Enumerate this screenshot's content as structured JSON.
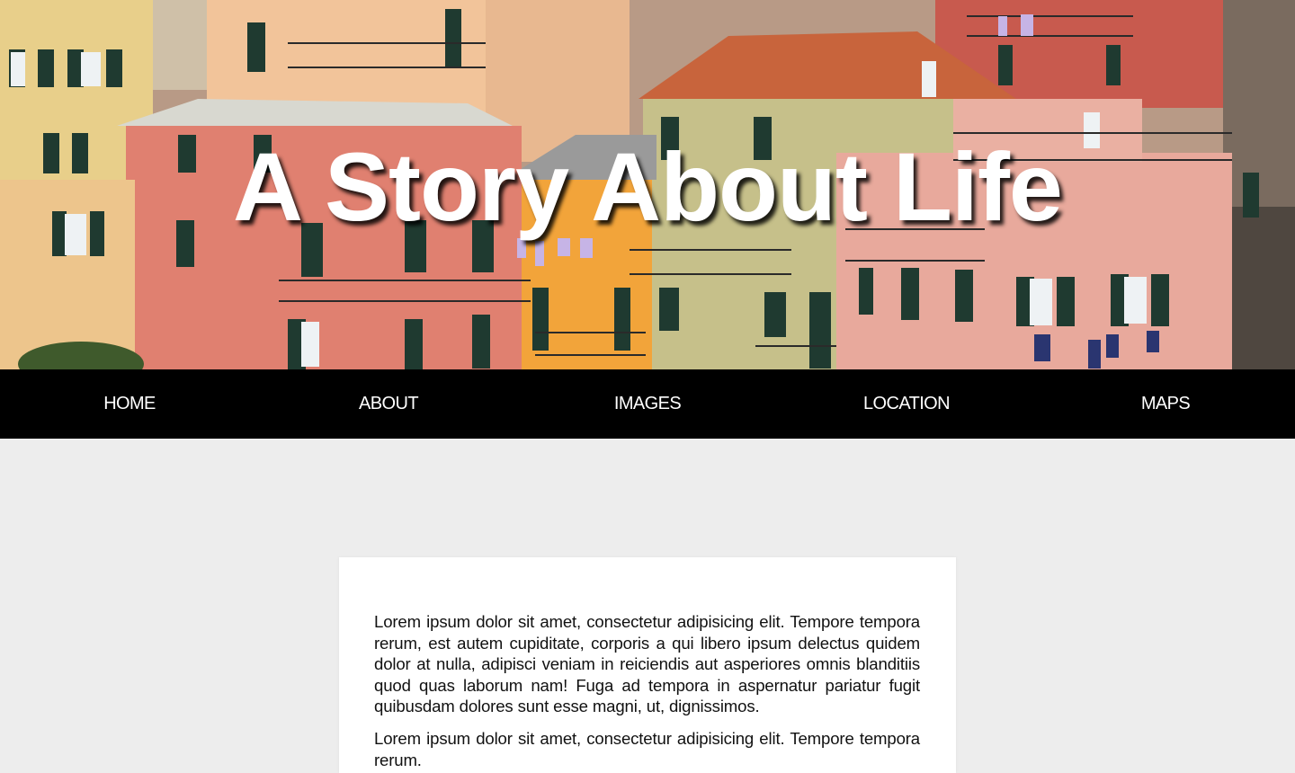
{
  "hero": {
    "title": "A Story About Life",
    "image": "hero-photo-colorful-houses"
  },
  "nav": {
    "items": [
      "HOME",
      "ABOUT",
      "IMAGES",
      "LOCATION",
      "MAPS"
    ]
  },
  "content": {
    "paragraphs": [
      "Lorem ipsum dolor sit amet, consectetur adipisicing elit. Tempore tempora rerum, est autem cupiditate, corporis a qui libero ipsum delectus quidem dolor at nulla, adipisci veniam in reiciendis aut asperiores omnis blanditiis quod quas laborum nam! Fuga ad tempora in aspernatur pariatur fugit quibusdam dolores sunt esse magni, ut, dignissimos.",
      "Lorem ipsum dolor sit amet, consectetur adipisicing elit. Tempore tempora rerum."
    ]
  },
  "colors": {
    "nav_background": "#000000",
    "page_background": "#ededed",
    "card_background": "#ffffff"
  }
}
